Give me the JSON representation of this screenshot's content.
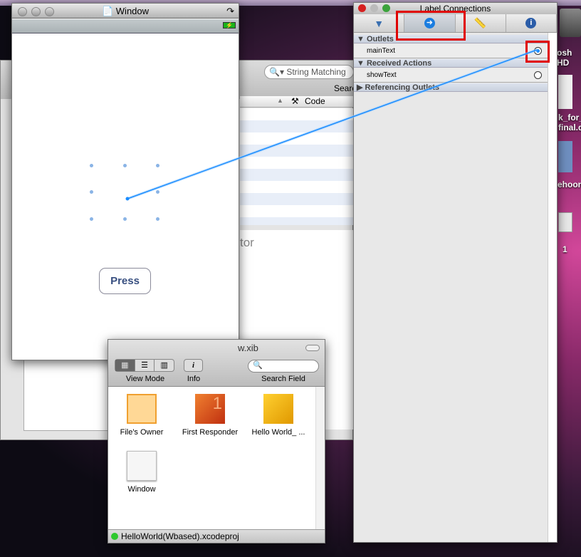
{
  "desktop": {
    "items": [
      {
        "label": "osh HD",
        "icon": "hard-drive-icon"
      },
      {
        "label": "k_for_ final.d",
        "icon": "document-icon"
      },
      {
        "label": "ehoon",
        "icon": "user-home-icon"
      },
      {
        "label": "1",
        "icon": "window-file-icon"
      }
    ]
  },
  "xcode": {
    "search_placeholder": "String Matching",
    "search_label": "Searc",
    "column_code": "Code",
    "editor_label": "tor"
  },
  "sim_window": {
    "title": "Window",
    "button_label": "Press"
  },
  "inspector": {
    "title": "Label Connections",
    "tabs": [
      {
        "icon": "attributes-icon"
      },
      {
        "icon": "connections-arrow-icon",
        "selected": true
      },
      {
        "icon": "ruler-size-icon"
      },
      {
        "icon": "info-icon"
      }
    ],
    "sections": {
      "outlets": "Outlets",
      "received_actions": "Received Actions",
      "referencing_outlets": "Referencing Outlets"
    },
    "outlets": [
      {
        "name": "mainText",
        "connected": true
      }
    ],
    "actions": [
      {
        "name": "showText",
        "connected": false
      }
    ],
    "highlight_color": "#e00000",
    "connection_color": "#1a8cff"
  },
  "xib": {
    "title": "w.xib",
    "view_mode_label": "View Mode",
    "info_label": "Info",
    "search_label": "Search Field",
    "objects": [
      {
        "label": "File's Owner"
      },
      {
        "label": "First Responder"
      },
      {
        "label": "Hello World_ ..."
      },
      {
        "label": "Window"
      }
    ],
    "status": "HelloWorld(Wbased).xcodeproj"
  }
}
